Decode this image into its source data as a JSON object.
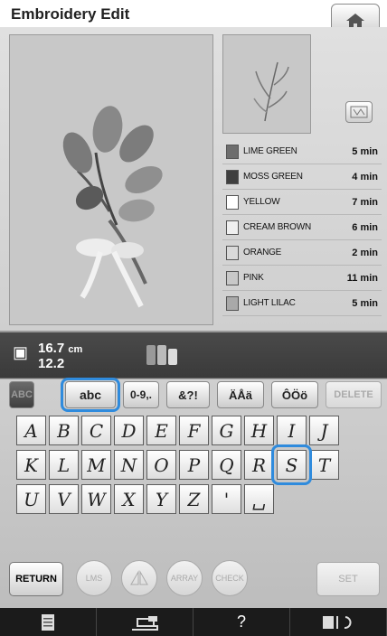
{
  "header": {
    "title": "Embroidery Edit",
    "home_icon": "home-icon"
  },
  "preview": {
    "icon": "embroidery-flower-pattern"
  },
  "thread_colors": [
    {
      "name": "LIME GREEN",
      "time": "5 min",
      "color": "#6d6d6d"
    },
    {
      "name": "MOSS GREEN",
      "time": "4 min",
      "color": "#3f3f3f"
    },
    {
      "name": "YELLOW",
      "time": "7 min",
      "color": "#ffffff"
    },
    {
      "name": "CREAM BROWN",
      "time": "6 min",
      "color": "#efefef"
    },
    {
      "name": "ORANGE",
      "time": "2 min",
      "color": "#d9d9d9"
    },
    {
      "name": "PINK",
      "time": "11 min",
      "color": "#c8c8c8"
    },
    {
      "name": "LIGHT LILAC",
      "time": "5 min",
      "color": "#a9a9a9"
    }
  ],
  "size": {
    "width": "16.7",
    "unit": "cm",
    "height_partial": "12.2"
  },
  "tabs": [
    {
      "label": "ABC",
      "state": "disabled"
    },
    {
      "label": "abc",
      "state": "highlighted"
    },
    {
      "label": "0-9,.",
      "state": "normal"
    },
    {
      "label": "&?!",
      "state": "normal"
    },
    {
      "label": "ÄÅä",
      "state": "normal"
    },
    {
      "label": "ÔÖö",
      "state": "normal"
    },
    {
      "label": "DELETE",
      "state": "disabled"
    }
  ],
  "keys": [
    [
      "A",
      "B",
      "C",
      "D",
      "E",
      "F",
      "G",
      "H",
      "I",
      "J"
    ],
    [
      "K",
      "L",
      "M",
      "N",
      "O",
      "P",
      "Q",
      "R",
      "S",
      "T"
    ],
    [
      "U",
      "V",
      "W",
      "X",
      "Y",
      "Z",
      "'",
      "␣"
    ]
  ],
  "highlighted_key": "S",
  "bottom": {
    "return_label": "RETURN",
    "lms_label": "LMS",
    "array_label": "ARRAY",
    "check_label": "CHECK",
    "set_label": "SET"
  },
  "footer": {
    "icons": [
      "document-icon",
      "sewing-machine-icon",
      "help-icon",
      "settings-icon"
    ],
    "help_label": "?"
  },
  "colors": {
    "highlight": "#2f8bdd",
    "panel": "#3a3a3a"
  }
}
